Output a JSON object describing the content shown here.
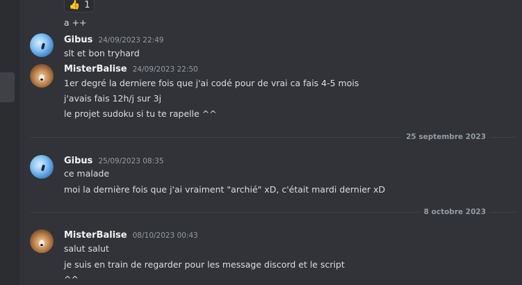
{
  "reaction": {
    "emoji": "👍",
    "count": "1"
  },
  "groups": [
    {
      "type": "continuation",
      "lines": [
        "a ++"
      ]
    },
    {
      "type": "message",
      "author": "Gibus",
      "timestamp": "24/09/2023 22:49",
      "avatar": "gibus-avatar",
      "lines": [
        "slt et bon tryhard"
      ]
    },
    {
      "type": "message",
      "author": "MisterBalise",
      "timestamp": "24/09/2023 22:50",
      "avatar": "misterbalise-avatar",
      "lines": [
        "1er degré la derniere fois que j'ai codé pour de vrai ca fais 4-5 mois",
        "j'avais fais 12h/j sur 3j",
        "le projet sudoku si tu te rapelle ^^"
      ]
    },
    {
      "type": "divider",
      "label": "25 septembre 2023"
    },
    {
      "type": "message",
      "author": "Gibus",
      "timestamp": "25/09/2023 08:35",
      "avatar": "gibus-avatar",
      "lines": [
        "ce malade",
        "moi la dernière fois que j'ai vraiment \"archié\" xD, c'était mardi dernier xD"
      ]
    },
    {
      "type": "divider",
      "label": "8 octobre 2023"
    },
    {
      "type": "message",
      "author": "MisterBalise",
      "timestamp": "08/10/2023 00:43",
      "avatar": "misterbalise-avatar",
      "lines": [
        "salut salut",
        "je suis en train de regarder pour les message discord et le script",
        "^^"
      ]
    }
  ]
}
